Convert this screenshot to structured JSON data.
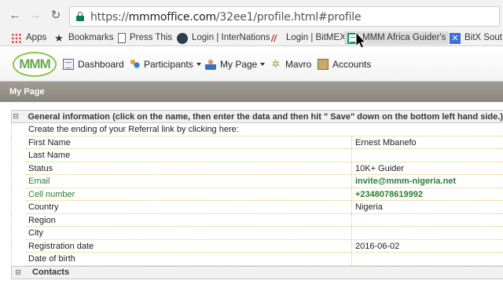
{
  "browser": {
    "url_scheme": "https://",
    "url_host": "mmmoffice.com",
    "url_path": "/32ee1/profile.html#profile",
    "bookmarks": [
      {
        "label": "Apps",
        "icon": "apps-grid-icon"
      },
      {
        "label": "Bookmarks",
        "icon": "star-icon"
      },
      {
        "label": "Press This",
        "icon": "document-icon"
      },
      {
        "label": "Login | InterNations",
        "icon": "globe-icon"
      },
      {
        "label": "Login | BitMEX",
        "icon": "bitmex-icon"
      },
      {
        "label": "MMM Africa Guider's",
        "icon": "spreadsheet-icon"
      },
      {
        "label": "BitX Sout",
        "icon": "x-icon"
      }
    ]
  },
  "app_nav": {
    "logo_text": "MMM",
    "items": [
      {
        "label": "Dashboard",
        "icon": "dashboard-icon",
        "dropdown": false
      },
      {
        "label": "Participants",
        "icon": "participants-icon",
        "dropdown": true
      },
      {
        "label": "My Page",
        "icon": "user-icon",
        "dropdown": true
      },
      {
        "label": "Mavro",
        "icon": "mavro-icon",
        "dropdown": false
      },
      {
        "label": "Accounts",
        "icon": "accounts-icon",
        "dropdown": false
      }
    ]
  },
  "page": {
    "title": "My Page"
  },
  "profile": {
    "general_group_label": "General information (click on the name, then enter the data and then hit \" Save\" down on the bottom left hand side.)",
    "referral_hint": "Create the ending of your Referral link by clicking here:",
    "fields": [
      {
        "label": "First Name",
        "value": "Ernest Mbanefo",
        "style": "normal"
      },
      {
        "label": "Last Name",
        "value": "",
        "style": "normal"
      },
      {
        "label": "Status",
        "value": "10K+ Guider",
        "style": "normal"
      },
      {
        "label": "Email",
        "value": "invite@mmm-nigeria.net",
        "style": "green"
      },
      {
        "label": "Cell number",
        "value": "+2348078619992",
        "style": "green"
      },
      {
        "label": "Country",
        "value": "Nigeria",
        "style": "normal"
      },
      {
        "label": "Region",
        "value": "",
        "style": "normal"
      },
      {
        "label": "City",
        "value": "",
        "style": "normal"
      },
      {
        "label": "Registration date",
        "value": "2016-06-02",
        "style": "normal"
      },
      {
        "label": "Date of birth",
        "value": "",
        "style": "normal"
      }
    ],
    "contacts_group_label": "Contacts",
    "toggle_symbol": "⊟"
  },
  "colors": {
    "green_text": "#2e7d32",
    "header_bar": "#8a867d",
    "dotted_border": "#e0c96b"
  }
}
